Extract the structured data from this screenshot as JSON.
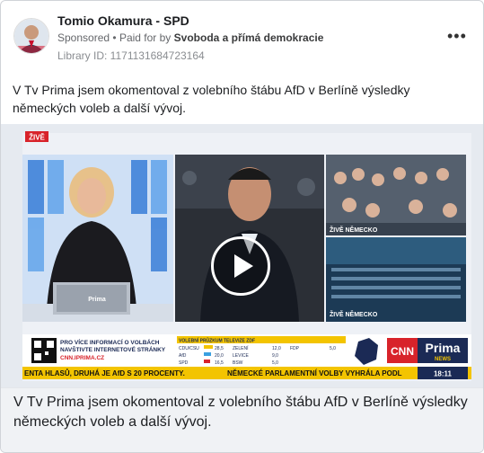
{
  "ad": {
    "page_name": "Tomio Okamura - SPD",
    "sponsored": "Sponsored",
    "paid_prefix": "Paid for by",
    "payer": "Svoboda a přímá demokracie",
    "library_id": "Library ID: 1171131684723164",
    "more_icon": "ellipsis-icon"
  },
  "post": {
    "text": "V Tv Prima jsem okomentoval z volebního štábu AfD v Berlíně výsledky německých voleb a další vývoj."
  },
  "video": {
    "live_badge": "ŽIVĚ",
    "live_label_top": "ŽIVĚ NĚMECKO",
    "live_label_bottom": "ŽIVĚ NĚMECKO",
    "promo_line1": "PRO VÍCE INFORMACÍ O VOLBÁCH",
    "promo_line2": "NAVŠTIVTE INTERNETOVÉ STRÁNKY",
    "promo_url": "CNN.IPRIMA.CZ",
    "poll_header": "VOLEBNÍ PRŮZKUM TELEVIZE ZDF",
    "poll_rows": [
      {
        "party": "CDU/CSU",
        "value": "28,5"
      },
      {
        "party": "AfD",
        "value": "20,0"
      },
      {
        "party": "SPD",
        "value": "16,5"
      }
    ],
    "poll_rows_b": [
      {
        "party": "ZELENÍ",
        "value": "12,0"
      },
      {
        "party": "LEVICE",
        "value": "9,0"
      },
      {
        "party": "BSW",
        "value": "5,0"
      }
    ],
    "poll_row_c": {
      "party": "FDP",
      "value": "5,0"
    },
    "brand_cnn": "CNN",
    "brand_prima": "Prima",
    "brand_news": "NEWS",
    "ticker_left": "ENTA HLASŮ, DRUHÁ JE AfD S 20 PROCENTY.",
    "ticker_right": "NĚMECKÉ PARLAMENTNÍ VOLBY VYHRÁLA PODL",
    "clock": "18:11",
    "laptop_logo": "Prima",
    "play_icon": "play-icon"
  },
  "caption": {
    "text": "V Tv Prima jsem okomentoval z volebního štábu AfD v Berlíně výsledky německých voleb a další vývoj."
  }
}
